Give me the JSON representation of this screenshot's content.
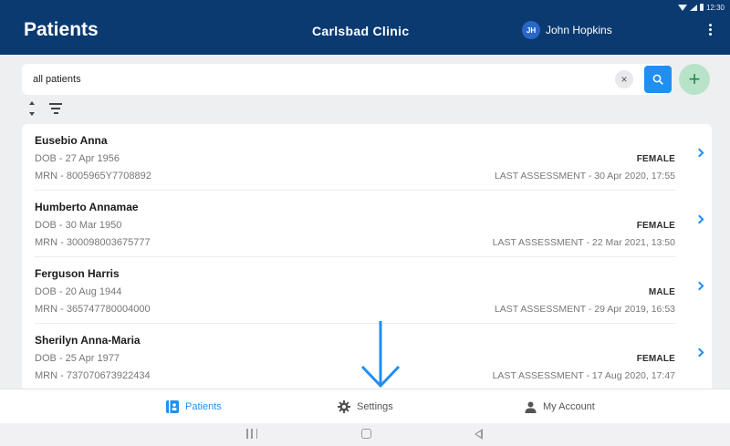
{
  "status_bar": {
    "time": "12:30"
  },
  "header": {
    "title": "Patients",
    "clinic": "Carlsbad Clinic",
    "user_initials": "JH",
    "user_name": "John Hopkins"
  },
  "search": {
    "value": "all patients",
    "clear_glyph": "×",
    "add_glyph": "+"
  },
  "patients": [
    {
      "name": "Eusebio Anna",
      "dob": "DOB - 27 Apr 1956",
      "mrn": "MRN - 8005965Y7708892",
      "gender": "FEMALE",
      "last_assessment": "LAST ASSESSMENT - 30 Apr 2020, 17:55"
    },
    {
      "name": "Humberto Annamae",
      "dob": "DOB - 30 Mar 1950",
      "mrn": "MRN - 300098003675777",
      "gender": "FEMALE",
      "last_assessment": "LAST ASSESSMENT - 22 Mar 2021, 13:50"
    },
    {
      "name": "Ferguson Harris",
      "dob": "DOB - 20 Aug 1944",
      "mrn": "MRN - 365747780004000",
      "gender": "MALE",
      "last_assessment": "LAST ASSESSMENT - 29 Apr 2019, 16:53"
    },
    {
      "name": "Sherilyn Anna-Maria",
      "dob": "DOB - 25 Apr 1977",
      "mrn": "MRN - 737070673922434",
      "gender": "FEMALE",
      "last_assessment": "LAST ASSESSMENT - 17 Aug 2020, 17:47"
    }
  ],
  "bottom_nav": {
    "patients": "Patients",
    "settings": "Settings",
    "my_account": "My Account"
  },
  "icons": {
    "search": "magnifier-icon",
    "sort": "sort-icon",
    "filter": "filter-icon",
    "patients": "patient-card-icon",
    "settings": "gear-icon",
    "account": "person-icon",
    "annotation": "down-arrow-icon"
  },
  "colors": {
    "header_bg": "#0b3a70",
    "accent_blue": "#1f8ff2",
    "add_button_bg": "#b9e3c9",
    "add_button_fg": "#1d8a48",
    "avatar_bg": "#2a66c7",
    "page_bg": "#eeeff1"
  }
}
